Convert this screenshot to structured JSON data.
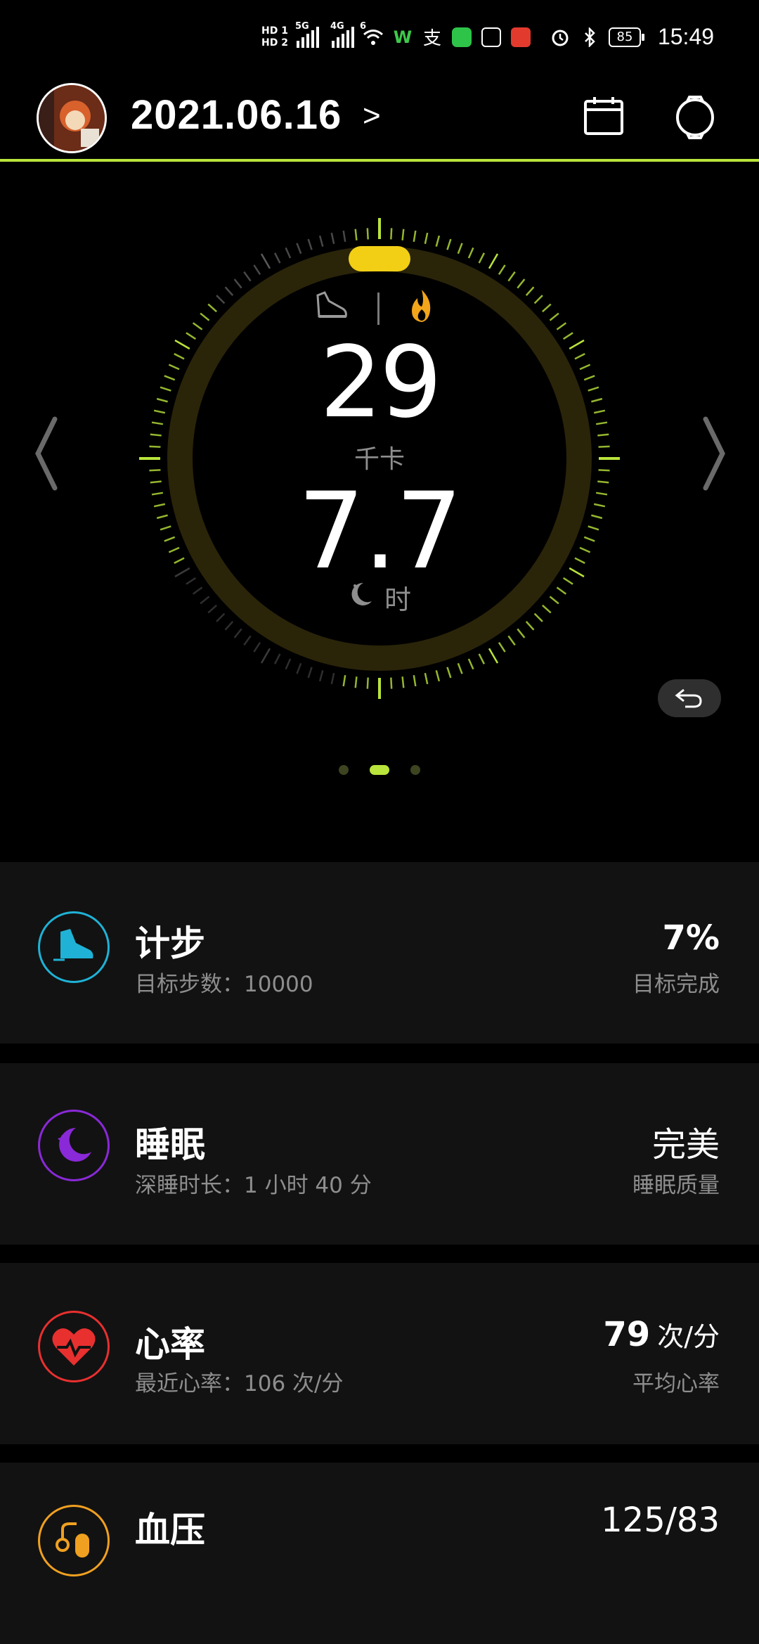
{
  "status_bar": {
    "sim1": "HD 1",
    "sim2": "HD 2",
    "sig1_tag": "5G",
    "sig2_tag": "4G",
    "wifi_tag": "6",
    "battery": "85",
    "time": "15:49",
    "icons": [
      "wifi-icon",
      "wechat-work-icon",
      "alipay-icon",
      "wechat-icon",
      "hand-icon",
      "app-icon",
      "alarm-icon",
      "bluetooth-icon"
    ]
  },
  "header": {
    "date": "2021.06.16",
    "date_chevron": ">",
    "calendar_icon": "calendar-icon",
    "watch_icon": "watch-icon"
  },
  "colors": {
    "accent": "#b9e43b",
    "ring_track": "#2a2409",
    "ring_marker": "#f2cf15",
    "steps": "#1fb2d6",
    "sleep": "#8a29d8",
    "heart": "#e8302f",
    "bp": "#f0a020"
  },
  "ring": {
    "modes": [
      "shoe-icon",
      "flame-icon"
    ],
    "calories_value": "29",
    "calories_unit": "千卡",
    "sleep_value": "7.7",
    "sleep_unit": "时",
    "sleep_icon": "moon-icon",
    "page_count": 3,
    "active_page": 1
  },
  "cards": [
    {
      "title": "计步",
      "subtitle": "目标步数：10000",
      "value": "7%",
      "value_unit": "",
      "label": "目标完成",
      "icon": "shoe-icon"
    },
    {
      "title": "睡眠",
      "subtitle": "深睡时长：1 小时 40 分",
      "value": "完美",
      "value_unit": "",
      "label": "睡眠质量",
      "icon": "moon-icon"
    },
    {
      "title": "心率",
      "subtitle": "最近心率：106 次/分",
      "value": "79",
      "value_unit": "次/分",
      "label": "平均心率",
      "icon": "heart-icon"
    },
    {
      "title": "血压",
      "subtitle": "",
      "value": "125/83",
      "value_unit": "",
      "label": "",
      "icon": "blood-pressure-icon"
    }
  ]
}
